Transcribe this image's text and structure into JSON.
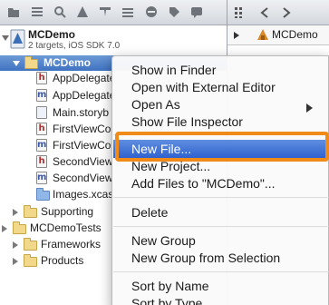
{
  "navigator": {
    "project": {
      "name": "MCDemo",
      "subtitle": "2 targets, iOS SDK 7.0"
    },
    "selected_group": "MCDemo",
    "files": [
      {
        "label": "AppDelegate",
        "icon": "header-file-icon",
        "kind": "h"
      },
      {
        "label": "AppDelegate",
        "icon": "implementation-file-icon",
        "kind": "m"
      },
      {
        "label": "Main.storyb",
        "icon": "storyboard-file-icon",
        "kind": "sb"
      },
      {
        "label": "FirstViewCo",
        "icon": "header-file-icon",
        "kind": "h"
      },
      {
        "label": "FirstViewCo",
        "icon": "implementation-file-icon",
        "kind": "m"
      },
      {
        "label": "SecondView",
        "icon": "header-file-icon",
        "kind": "h"
      },
      {
        "label": "SecondView",
        "icon": "implementation-file-icon",
        "kind": "m"
      },
      {
        "label": "Images.xcas",
        "icon": "asset-catalog-icon",
        "kind": "xcassets"
      }
    ],
    "groups": [
      {
        "label": "Supporting",
        "icon": "folder-icon"
      },
      {
        "label": "MCDemoTests",
        "icon": "folder-icon"
      },
      {
        "label": "Frameworks",
        "icon": "folder-icon"
      },
      {
        "label": "Products",
        "icon": "folder-icon"
      }
    ]
  },
  "editor": {
    "jump_bar_label": "MCDemo"
  },
  "context_menu": {
    "highlighted": "New File...",
    "sections": [
      [
        "Show in Finder",
        "Open with External Editor",
        "Open As",
        "Show File Inspector"
      ],
      [
        "New File...",
        "New Project...",
        "Add Files to \"MCDemo\"..."
      ],
      [
        "Delete"
      ],
      [
        "New Group",
        "New Group from Selection"
      ],
      [
        "Sort by Name",
        "Sort by Type"
      ]
    ]
  },
  "colors": {
    "selection": "#3f72c1",
    "menu_highlight": "#2f62cf",
    "callout": "#f08a18"
  }
}
